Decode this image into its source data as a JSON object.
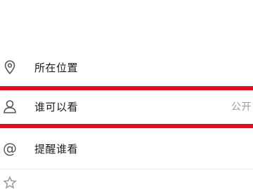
{
  "rows": [
    {
      "icon": "location-pin-icon",
      "label": "所在位置",
      "value": ""
    },
    {
      "icon": "person-icon",
      "label": "谁可以看",
      "value": "公开"
    },
    {
      "icon": "at-icon",
      "label": "提醒谁看",
      "value": ""
    },
    {
      "icon": "star-icon",
      "label": "",
      "value": ""
    }
  ],
  "glyphs": {
    "at": "@"
  },
  "colors": {
    "highlight": "#e0101e",
    "label": "#1a1a1a",
    "value": "#9a9a9a",
    "icon": "#555555"
  }
}
